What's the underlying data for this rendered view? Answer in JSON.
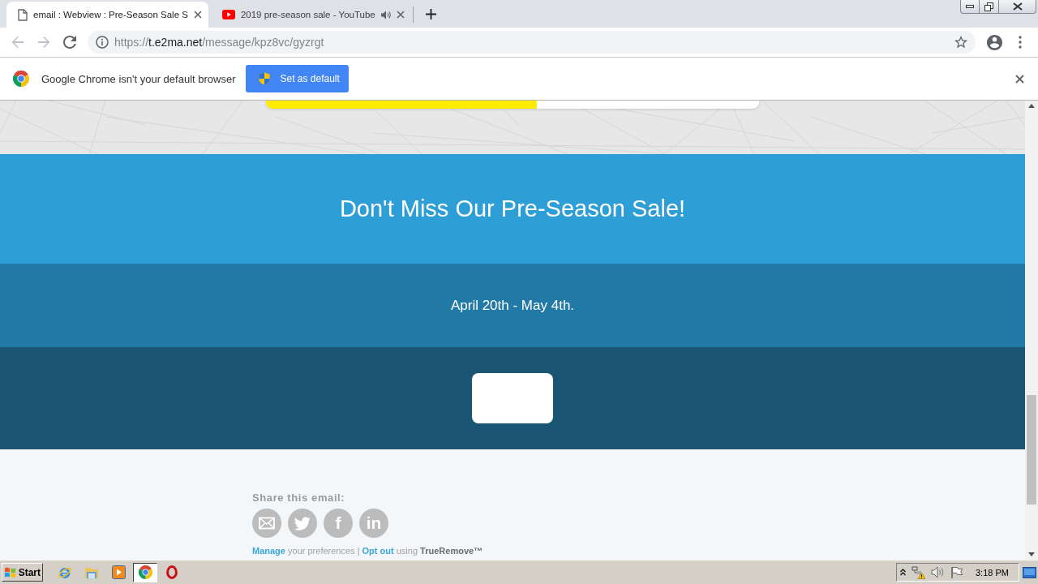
{
  "tabs": [
    {
      "kind": "page",
      "title": "email : Webview : Pre-Season Sale S",
      "selected": true,
      "audio": false
    },
    {
      "kind": "video",
      "title": "2019 pre-season sale - YouTube",
      "selected": false,
      "audio": true
    }
  ],
  "toolbar": {
    "back": {
      "disabled": true
    },
    "forward": {
      "disabled": true
    },
    "url": {
      "scheme": "https://",
      "host": "t.e2ma.net",
      "path": "/message/kpz8vc/gyzrgt"
    }
  },
  "infobar": {
    "message": "Google Chrome isn't your default browser",
    "button": "Set as default"
  },
  "banner": {
    "progress": {
      "level": 0.55
    }
  },
  "headline": "Don't Miss Our Pre-Season Sale!",
  "dates": "April 20th - May 4th.",
  "footer": {
    "share_label": "Share this email:",
    "share_buttons": [
      {
        "kind": "envelope"
      },
      {
        "kind": "bird"
      },
      {
        "kind": "letters",
        "text": "f"
      },
      {
        "kind": "letters",
        "text": "in"
      }
    ],
    "links_line": [
      {
        "kind": "link",
        "text": "Manage"
      },
      {
        "kind": "plain",
        "text": "your preferences |"
      },
      {
        "kind": "link",
        "text": "Opt out"
      },
      {
        "kind": "plain",
        "text": "using"
      },
      {
        "kind": "strong",
        "text": "TrueRemove™"
      }
    ]
  },
  "taskbar": {
    "start": "Start",
    "apps": [
      {
        "kind": "globe",
        "selected": false
      },
      {
        "kind": "folder",
        "selected": false
      },
      {
        "kind": "play-tile",
        "selected": false
      },
      {
        "kind": "tricolor-ball",
        "selected": true
      },
      {
        "kind": "red-ring",
        "selected": false
      }
    ],
    "clock": "3:18 PM"
  }
}
